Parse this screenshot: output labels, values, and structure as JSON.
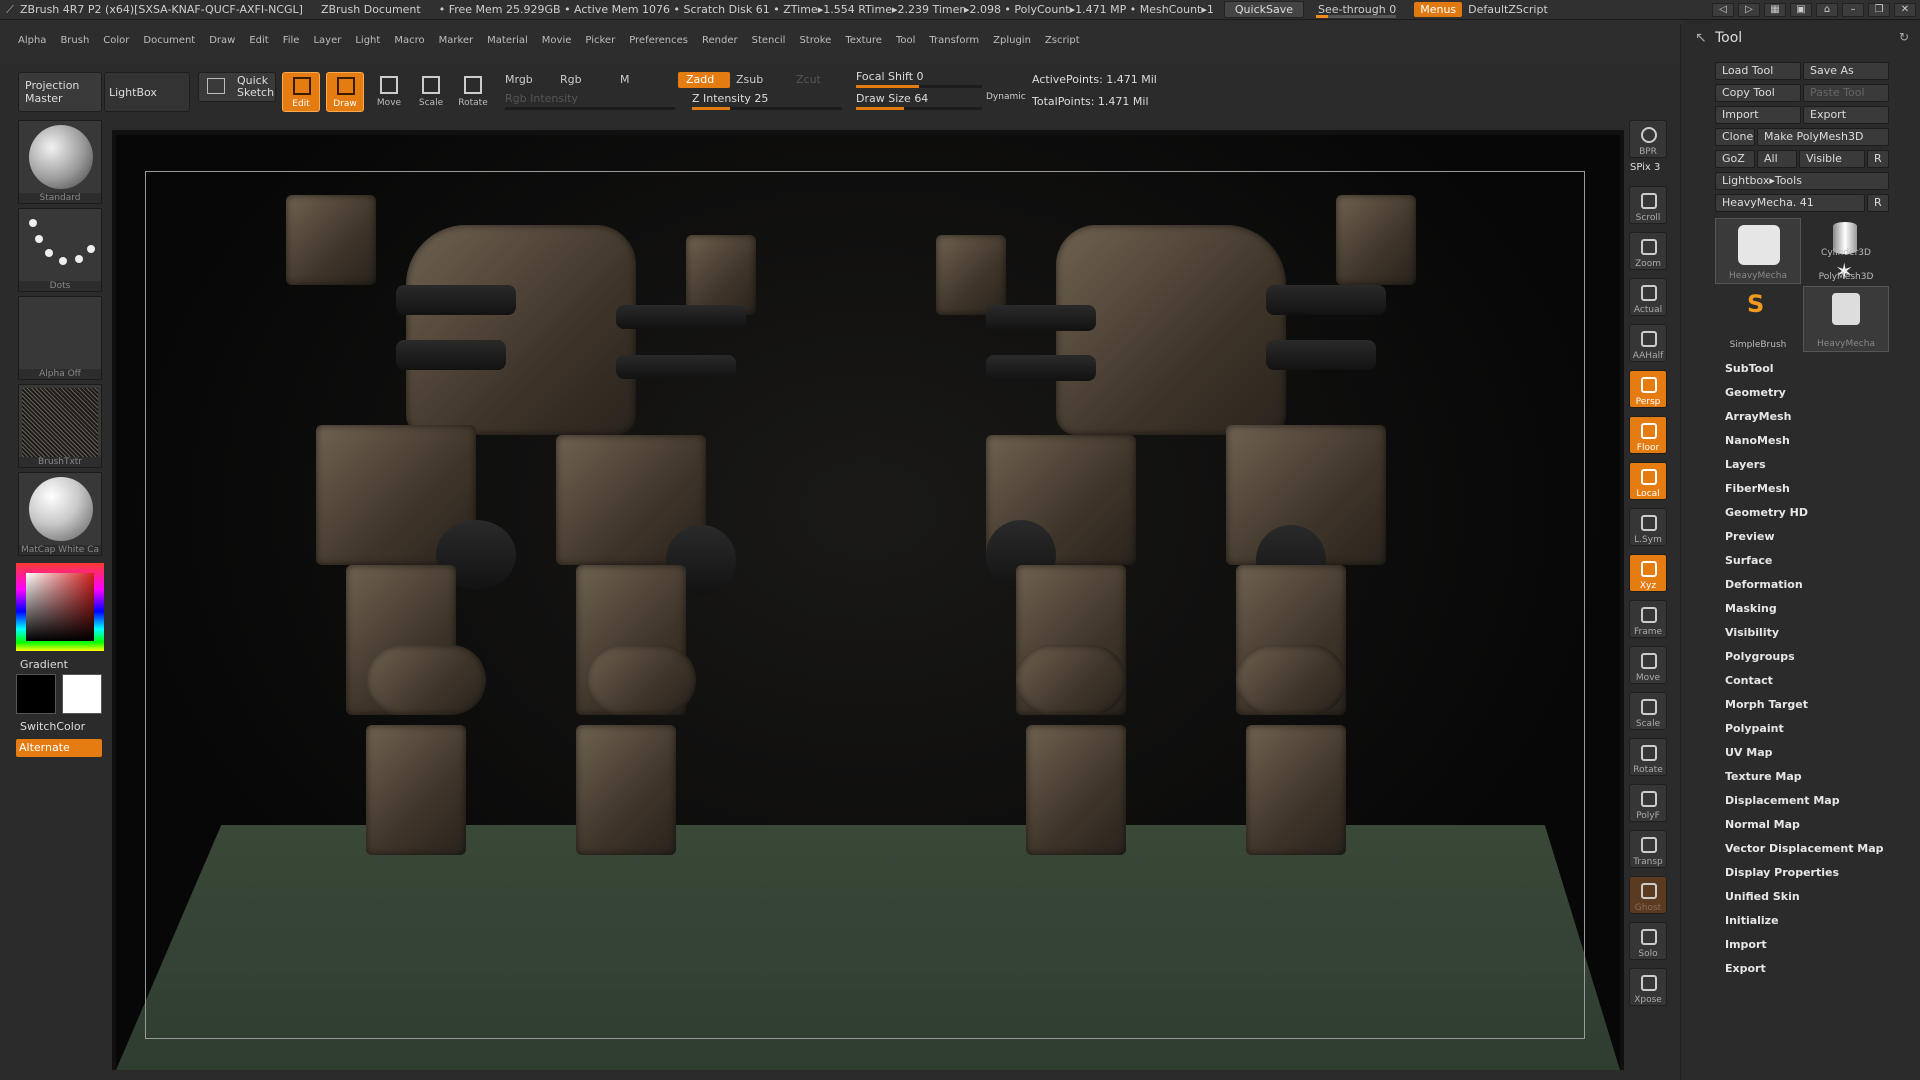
{
  "titlebar": {
    "app": "ZBrush 4R7 P2 (x64)[SXSA-KNAF-QUCF-AXFI-NCGL]",
    "doc": "ZBrush Document",
    "stats": "• Free Mem 25.929GB • Active Mem 1076 • Scratch Disk 61 • ZTime▸1.554 RTime▸2.239 Timer▸2.098 • PolyCount▸1.471 MP • MeshCount▸1",
    "quicksave": "QuickSave",
    "see_through": "See-through",
    "see_through_value": "0",
    "see_through_level": 0.0,
    "menus": "Menus",
    "ui_layout": "DefaultZScript"
  },
  "menubar": [
    "Alpha",
    "Brush",
    "Color",
    "Document",
    "Draw",
    "Edit",
    "File",
    "Layer",
    "Light",
    "Macro",
    "Marker",
    "Material",
    "Movie",
    "Picker",
    "Preferences",
    "Render",
    "Stencil",
    "Stroke",
    "Texture",
    "Tool",
    "Transform",
    "Zplugin",
    "Zscript"
  ],
  "shelf": {
    "projection_master": "Projection Master",
    "lightbox": "LightBox",
    "quick_sketch": "Quick Sketch",
    "modes": [
      {
        "label": "Edit",
        "on": true
      },
      {
        "label": "Draw",
        "on": true
      },
      {
        "label": "Move",
        "on": false
      },
      {
        "label": "Scale",
        "on": false
      },
      {
        "label": "Rotate",
        "on": false
      }
    ],
    "mrgb": "Mrgb",
    "rgb": "Rgb",
    "m": "M",
    "rgb_intensity": "Rgb Intensity",
    "zadd": "Zadd",
    "zsub": "Zsub",
    "zcut": "Zcut",
    "z_intensity_label": "Z Intensity",
    "z_intensity": 25,
    "focal_shift_label": "Focal Shift",
    "focal_shift": 0,
    "draw_size_label": "Draw Size",
    "draw_size": 64,
    "dynamic": "Dynamic",
    "active_points": "ActivePoints: 1.471 Mil",
    "total_points": "TotalPoints: 1.471 Mil"
  },
  "left": {
    "brush": "Standard",
    "stroke": "Dots",
    "alpha": "Alpha Off",
    "texture": "BrushTxtr",
    "material": "MatCap White Ca",
    "gradient": "Gradient",
    "switch_color": "SwitchColor",
    "alternate": "Alternate",
    "primary_color": "#000000",
    "secondary_color": "#ffffff"
  },
  "rstrip": {
    "bpr": "BPR",
    "spix": "SPix 3",
    "buttons": [
      "Scroll",
      "Zoom",
      "Actual",
      "AAHalf",
      "Persp",
      "Floor",
      "Local",
      "L.Sym",
      "Xyz",
      "Frame",
      "Move",
      "Scale",
      "Rotate",
      "PolyF",
      "Transp",
      "Ghost",
      "Solo",
      "Xpose"
    ]
  },
  "tool": {
    "title": "Tool",
    "load_tool": "Load Tool",
    "save_as": "Save As",
    "copy_tool": "Copy Tool",
    "paste_tool": "Paste Tool",
    "import": "Import",
    "export": "Export",
    "clone": "Clone",
    "make_polymesh": "Make PolyMesh3D",
    "goz": "GoZ",
    "all": "All",
    "visible": "Visible",
    "r": "R",
    "lightbox_tools": "Lightbox▸Tools",
    "current_tool": "HeavyMecha. 41",
    "tools": [
      "HeavyMecha",
      "Cylinder3D",
      "PolyMesh3D",
      "SimpleBrush",
      "HeavyMecha"
    ],
    "subpalettes": [
      "SubTool",
      "Geometry",
      "ArrayMesh",
      "NanoMesh",
      "Layers",
      "FiberMesh",
      "Geometry HD",
      "Preview",
      "Surface",
      "Deformation",
      "Masking",
      "Visibility",
      "Polygroups",
      "Contact",
      "Morph Target",
      "Polypaint",
      "UV Map",
      "Texture Map",
      "Displacement Map",
      "Normal Map",
      "Vector Displacement Map",
      "Display Properties",
      "Unified Skin",
      "Initialize",
      "Import",
      "Export"
    ]
  }
}
